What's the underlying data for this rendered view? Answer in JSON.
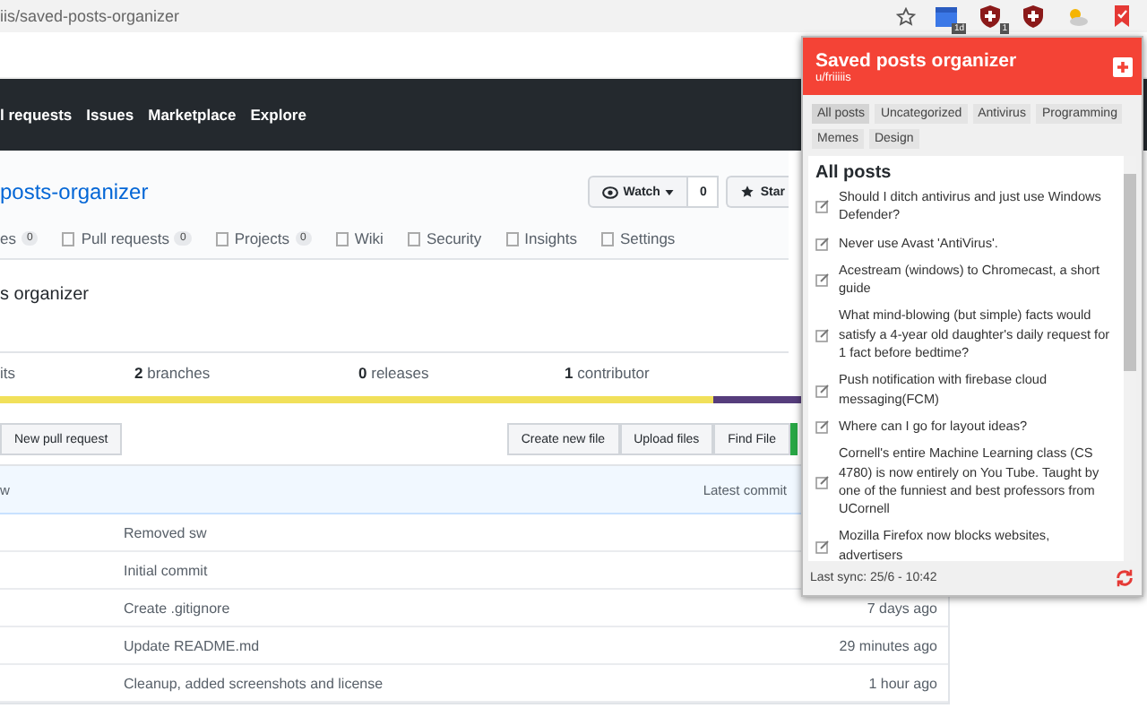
{
  "browser": {
    "url": "iis/saved-posts-organizer",
    "toolbar_icons": [
      {
        "kind": "calendar",
        "badge": "1d"
      },
      {
        "kind": "shield",
        "badge": "1"
      },
      {
        "kind": "shield"
      },
      {
        "kind": "weather"
      },
      {
        "kind": "bookmark"
      }
    ]
  },
  "nav": [
    "l requests",
    "Issues",
    "Marketplace",
    "Explore"
  ],
  "repo": {
    "title": "posts-organizer",
    "watch": {
      "label": "Watch",
      "count": "0"
    },
    "star": "Star",
    "tabs": [
      {
        "label": "es",
        "count": "0"
      },
      {
        "label": "Pull requests",
        "count": "0"
      },
      {
        "label": "Projects",
        "count": "0"
      },
      {
        "label": "Wiki"
      },
      {
        "label": "Security"
      },
      {
        "label": "Insights"
      },
      {
        "label": "Settings"
      }
    ],
    "description": "s organizer",
    "stats": [
      {
        "label": "its"
      },
      {
        "value": "2",
        "label": "branches"
      },
      {
        "value": "0",
        "label": "releases"
      },
      {
        "value": "1",
        "label": "contributor"
      }
    ],
    "languages": [
      {
        "color": "#f1e05a",
        "level": 0.89
      },
      {
        "color": "#563d7c",
        "level": 0.11
      }
    ],
    "left_buttons": [
      "New pull request"
    ],
    "file_buttons": [
      "Create new file",
      "Upload files",
      "Find File"
    ],
    "commit_header": {
      "left": "w",
      "right": "Latest commit"
    },
    "rows": [
      {
        "message": "Removed sw"
      },
      {
        "message": "Initial commit"
      },
      {
        "message": "Create .gitignore",
        "age": "7 days ago"
      },
      {
        "message": "Update README.md",
        "age": "29 minutes ago"
      },
      {
        "message": "Cleanup, added screenshots and license",
        "age": "1 hour ago"
      }
    ]
  },
  "popup": {
    "title": "Saved posts organizer",
    "user": "u/friiiiis",
    "tags": [
      {
        "label": "All posts",
        "selected": true
      },
      {
        "label": "Uncategorized",
        "selected": false
      },
      {
        "label": "Antivirus",
        "selected": false
      },
      {
        "label": "Programming",
        "selected": false
      },
      {
        "label": "Memes",
        "selected": false
      },
      {
        "label": "Design",
        "selected": false
      }
    ],
    "heading": "All posts",
    "posts": [
      "Should I ditch antivirus and just use Windows Defender?",
      "Never use Avast 'AntiVirus'.",
      "Acestream (windows) to Chromecast, a short guide",
      "What mind-blowing (but simple) facts would satisfy a 4-year old daughter's daily request for 1 fact before bedtime?",
      "Push notification with firebase cloud messaging(FCM)",
      "Where can I go for layout ideas?",
      "Cornell's entire Machine Learning class (CS 4780) is now entirely on You Tube. Taught by one of the funniest and best professors from UCornell",
      "Mozilla Firefox now blocks websites, advertisers"
    ],
    "last_sync": "Last sync: 25/6 - 10:42"
  }
}
